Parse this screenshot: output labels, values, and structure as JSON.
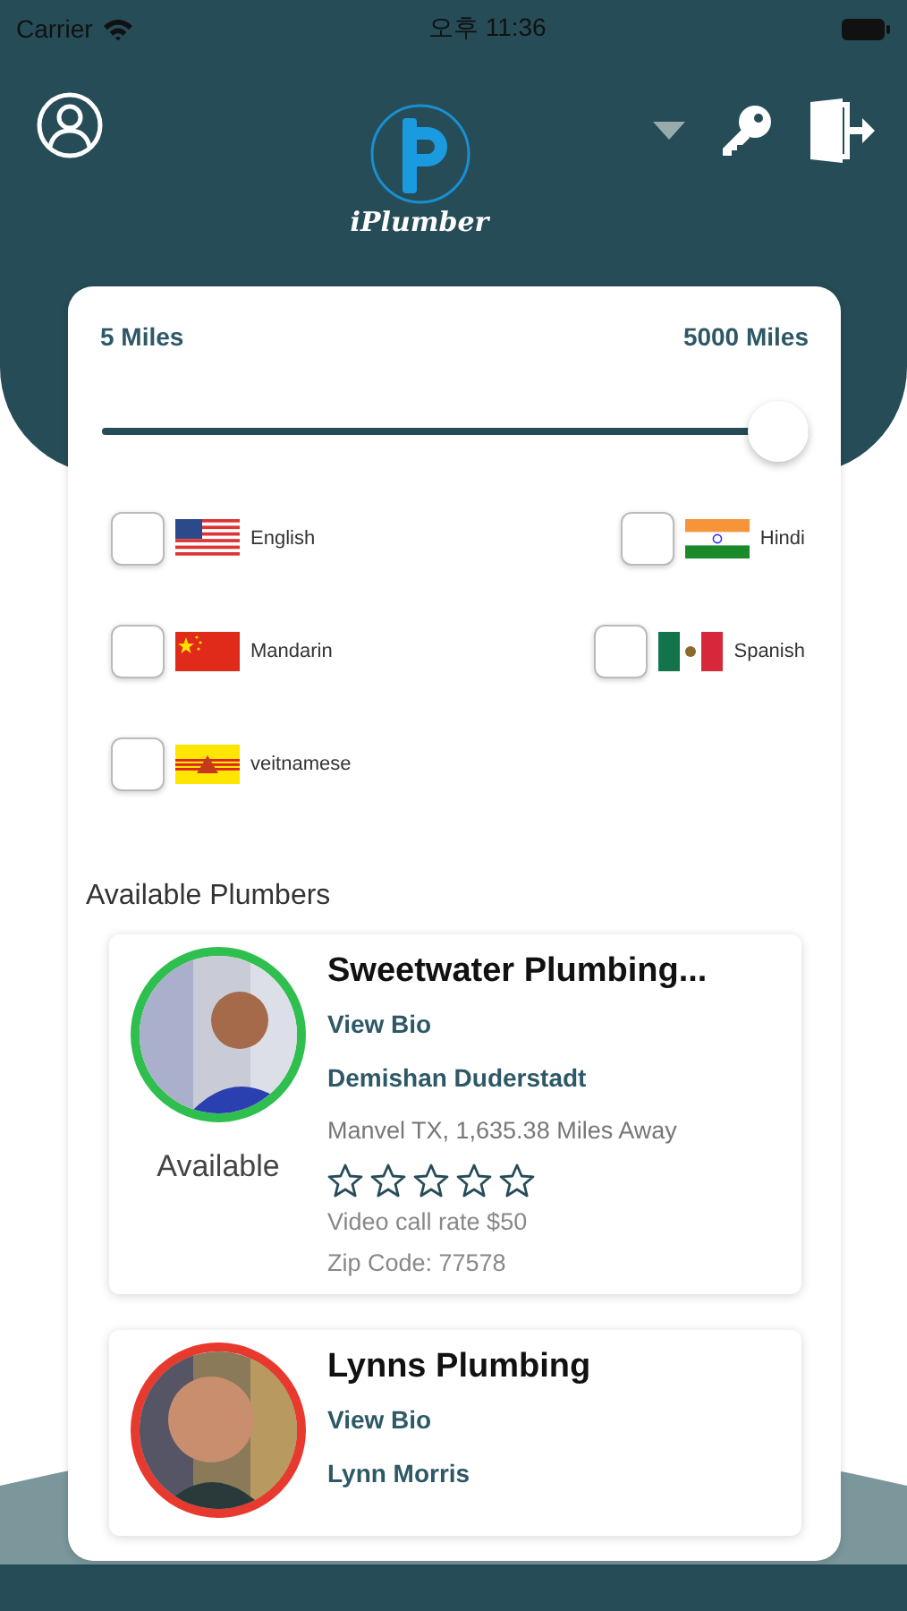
{
  "status_bar": {
    "carrier": "Carrier",
    "time": "오후 11:36"
  },
  "header": {
    "logo_text": "iPlumber"
  },
  "distance": {
    "min_label": "5 Miles",
    "max_label": "5000 Miles",
    "level": 1.0
  },
  "languages": [
    {
      "label": "English",
      "kind": "us",
      "checked": false
    },
    {
      "label": "Hindi",
      "kind": "in",
      "checked": false
    },
    {
      "label": "Mandarin",
      "kind": "cn",
      "checked": false
    },
    {
      "label": "Spanish",
      "kind": "mx",
      "checked": false
    },
    {
      "label": "veitnamese",
      "kind": "vn",
      "checked": false
    }
  ],
  "section_title": "Available Plumbers",
  "plumbers": [
    {
      "company": "Sweetwater Plumbing...",
      "bio_link": "View Bio",
      "owner": "Demishan Duderstadt",
      "status": "Available",
      "color": "#2fbf4f",
      "location": "Manvel TX, 1,635.38 Miles Away",
      "stars": 0,
      "rate": "Video call rate $50",
      "zip": "Zip Code: 77578"
    },
    {
      "company": "Lynns Plumbing",
      "bio_link": "View Bio",
      "owner": "Lynn Morris",
      "color": "#e8392e"
    }
  ]
}
